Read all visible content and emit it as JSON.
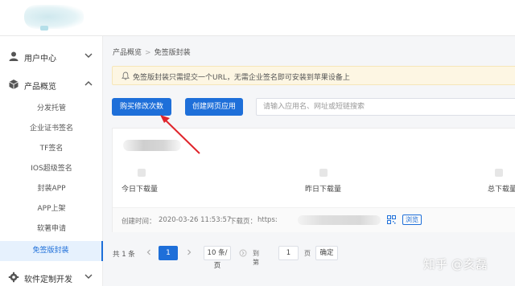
{
  "sidebar": {
    "user_center": "用户中心",
    "product_overview": "产品概览",
    "sub_items": [
      "分发托管",
      "企业证书签名",
      "TF签名",
      "IOS超级签名",
      "封装APP",
      "APP上架",
      "软著申请",
      "免签版封装"
    ],
    "custom_dev": "软件定制开发"
  },
  "breadcrumb": {
    "first": "产品概览",
    "separator": ">",
    "second": "免签版封装"
  },
  "notice": {
    "text": "免签版封装只需提交一个URL，无需企业签名即可安装到苹果设备上"
  },
  "toolbar": {
    "buy_label": "购买修改次数",
    "create_label": "创建网页应用",
    "search_placeholder": "请输入应用名、网址或短链搜索"
  },
  "app_card": {
    "stats": [
      "今日下载量",
      "昨日下载量",
      "总下载量"
    ],
    "created_label": "创建时间：",
    "created_value": "2020-03-26 11:53:57",
    "download_label": "下载页：",
    "download_prefix": "https:",
    "browse_label": "浏览"
  },
  "pagination": {
    "total": "共 1 条",
    "current_page": "1",
    "page_size": "10 条/页",
    "goto_label": "到第",
    "goto_value": "1",
    "page_label": "页",
    "confirm_label": "确定"
  },
  "watermark": "知乎 @亥磊",
  "colors": {
    "primary": "#1e6fd9",
    "annotation_arrow": "#e0242b",
    "notice_bg": "#fdf6e3"
  }
}
